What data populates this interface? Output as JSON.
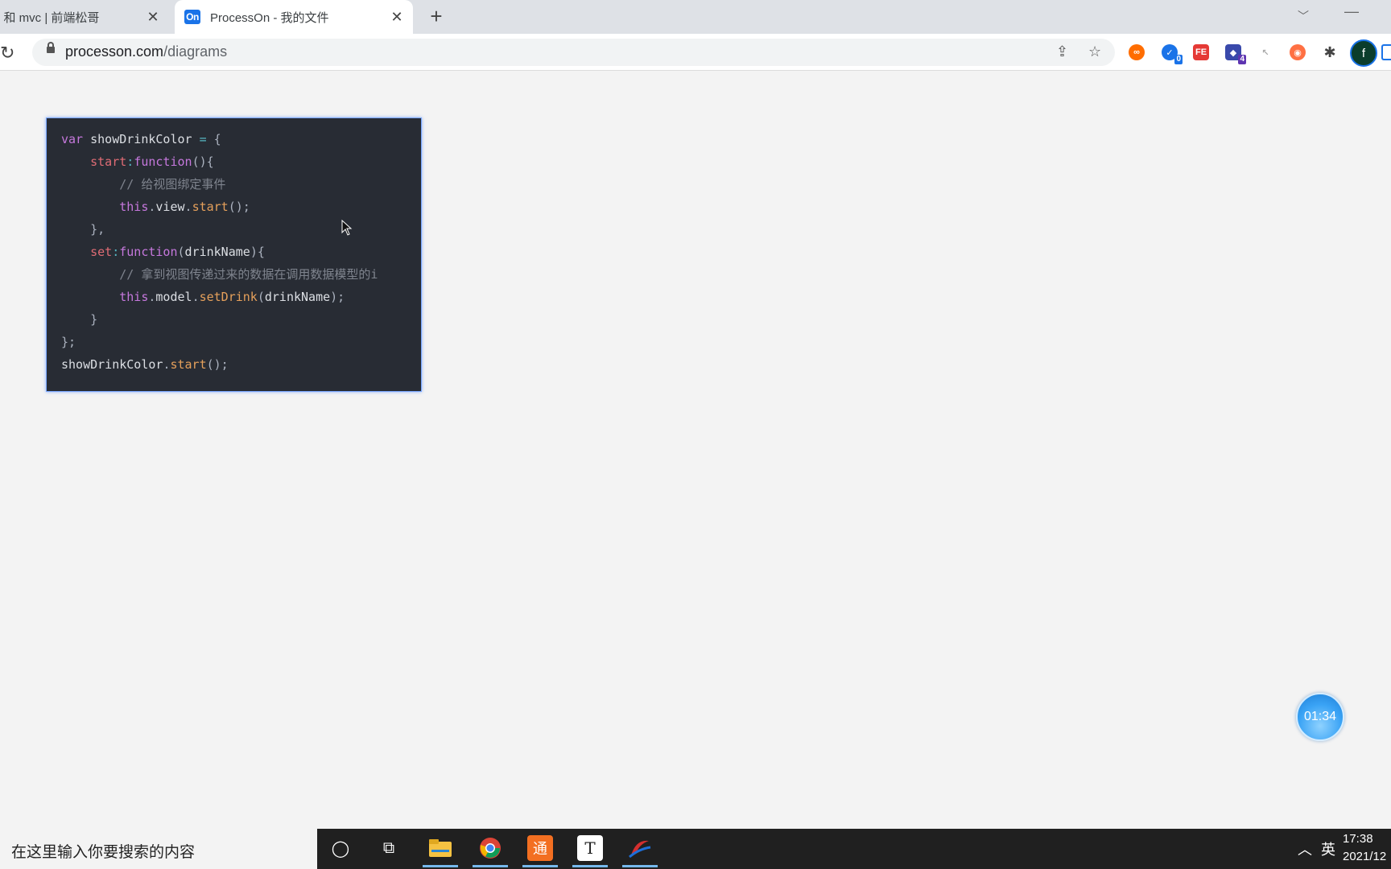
{
  "browser": {
    "tabs": [
      {
        "title": "n 和 mvc | 前端松哥",
        "active": false
      },
      {
        "title": "ProcessOn - 我的文件",
        "active": true,
        "favicon": "On"
      }
    ],
    "new_tab": "+",
    "close_glyph": "✕",
    "url_host": "processon.com",
    "url_path": "/diagrams",
    "extensions": [
      {
        "name": "infinity-extension-icon",
        "color": "#ff6d00",
        "glyph": "∞"
      },
      {
        "name": "checklist-extension-icon",
        "color": "#1a73e8",
        "glyph": "✓",
        "badge": "0"
      },
      {
        "name": "fe-extension-icon",
        "color": "#e53935",
        "glyph": "FE"
      },
      {
        "name": "cube-extension-icon",
        "color": "#3949ab",
        "glyph": "◆",
        "badge": "4"
      },
      {
        "name": "cursor-extension-icon",
        "color": "#bdbdbd",
        "glyph": "↖"
      },
      {
        "name": "orange-extension-icon",
        "color": "#ff7043",
        "glyph": "◉"
      },
      {
        "name": "puzzle-extension-icon",
        "color": "#555555",
        "glyph": "✱"
      }
    ],
    "profile_initial": "f"
  },
  "code": {
    "lines": [
      "var showDrinkColor = {",
      "    start:function(){",
      "        // 给视图绑定事件",
      "        this.view.start();",
      "    },",
      "    set:function(drinkName){",
      "        // 拿到视图传递过来的数据在调用数据模型的i",
      "        this.model.setDrink(drinkName);",
      "    }",
      "};",
      "showDrinkColor.start();"
    ]
  },
  "timer": {
    "value": "01:34"
  },
  "taskbar": {
    "search_placeholder": "在这里输入你要搜索的内容",
    "ime": "英",
    "time": "17:38",
    "date": "2021/12"
  }
}
